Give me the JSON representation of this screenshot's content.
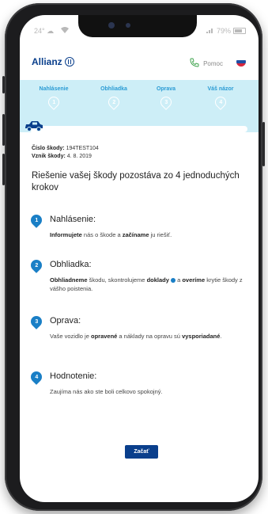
{
  "status_bar": {
    "temperature": "24°",
    "battery": "79%"
  },
  "header": {
    "logo_text": "Allianz",
    "help_label": "Pomoc"
  },
  "steps": [
    {
      "label": "Nahlásenie",
      "number": "1"
    },
    {
      "label": "Obhliadka",
      "number": "2"
    },
    {
      "label": "Oprava",
      "number": "3"
    },
    {
      "label": "Váš názor",
      "number": "4"
    }
  ],
  "progress": {
    "fraction": 0.0
  },
  "claim": {
    "number_label": "Číslo škody:",
    "number_value": "194TEST104",
    "date_label": "Vznik škody:",
    "date_value": "4. 8. 2019"
  },
  "intro": "Riešenie vašej škody pozostáva zo 4 jednoduchých krokov",
  "items": [
    {
      "number": "1",
      "title": "Nahlásenie:",
      "t1b": "Informujete",
      "t2": " nás o škode a ",
      "t3b": "začíname",
      "t4": " ju riešiť."
    },
    {
      "number": "2",
      "title": "Obhliadka:",
      "t1b": "Obhliadneme",
      "t2": " škodu, skontrolujeme ",
      "t3b": "doklady",
      "t4": " a ",
      "t5b": "overíme",
      "t6": " krytie škody z vášho poistenia."
    },
    {
      "number": "3",
      "title": "Oprava:",
      "t1": "Vaše vozidlo je ",
      "t2b": "opravené",
      "t3": " a náklady na opravu sú ",
      "t4b": "vysporiadané",
      "t5": "."
    },
    {
      "number": "4",
      "title": "Hodnotenie:",
      "t1": "Zaujíma nás ako ste boli celkovo spokojný."
    }
  ],
  "cta": {
    "label": "Začať"
  },
  "colors": {
    "brand": "#0a3f8c",
    "accent": "#1a7fc6",
    "step_band": "#cdeef7"
  }
}
